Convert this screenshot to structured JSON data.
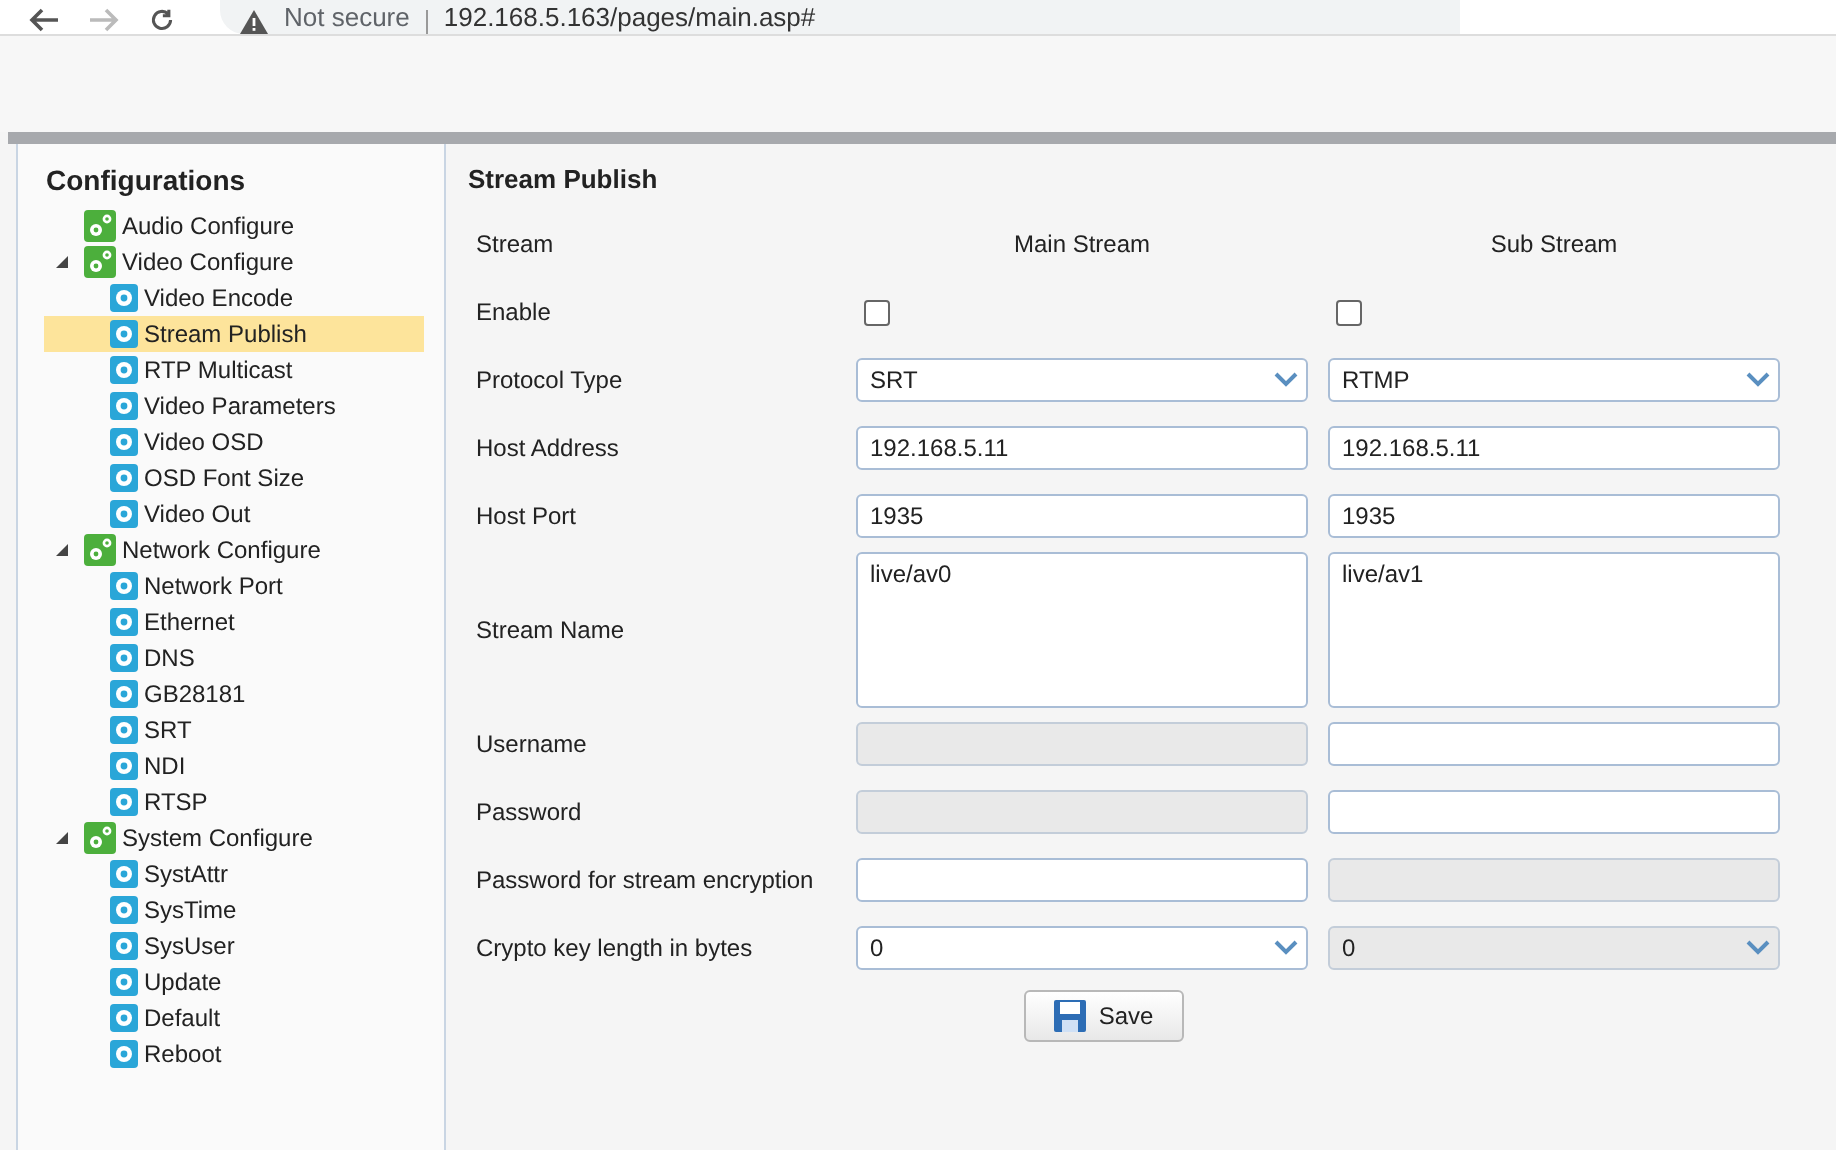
{
  "browser": {
    "security": "Not secure",
    "url": "192.168.5.163/pages/main.asp#"
  },
  "sidebar": {
    "title": "Configurations",
    "items": [
      {
        "label": "Audio Configure",
        "expanded": false,
        "selected": false
      },
      {
        "label": "Video Configure",
        "expanded": true,
        "selected": false,
        "children": [
          {
            "label": "Video Encode",
            "selected": false
          },
          {
            "label": "Stream Publish",
            "selected": true
          },
          {
            "label": "RTP Multicast",
            "selected": false
          },
          {
            "label": "Video Parameters",
            "selected": false
          },
          {
            "label": "Video OSD",
            "selected": false
          },
          {
            "label": "OSD Font Size",
            "selected": false
          },
          {
            "label": "Video Out",
            "selected": false
          }
        ]
      },
      {
        "label": "Network Configure",
        "expanded": true,
        "selected": false,
        "children": [
          {
            "label": "Network Port",
            "selected": false
          },
          {
            "label": "Ethernet",
            "selected": false
          },
          {
            "label": "DNS",
            "selected": false
          },
          {
            "label": "GB28181",
            "selected": false
          },
          {
            "label": "SRT",
            "selected": false
          },
          {
            "label": "NDI",
            "selected": false
          },
          {
            "label": "RTSP",
            "selected": false
          }
        ]
      },
      {
        "label": "System Configure",
        "expanded": true,
        "selected": false,
        "children": [
          {
            "label": "SystAttr",
            "selected": false
          },
          {
            "label": "SysTime",
            "selected": false
          },
          {
            "label": "SysUser",
            "selected": false
          },
          {
            "label": "Update",
            "selected": false
          },
          {
            "label": "Default",
            "selected": false
          },
          {
            "label": "Reboot",
            "selected": false
          }
        ]
      }
    ]
  },
  "panel": {
    "title": "Stream Publish",
    "header": {
      "label": "Stream",
      "columns": [
        "Main Stream",
        "Sub Stream"
      ]
    },
    "rows": [
      {
        "label": "Enable",
        "kind": "checkbox",
        "fields": [
          {
            "checked": false
          },
          {
            "checked": false
          }
        ]
      },
      {
        "label": "Protocol Type",
        "kind": "select",
        "fields": [
          {
            "value": "SRT",
            "disabled": false
          },
          {
            "value": "RTMP",
            "disabled": false
          }
        ]
      },
      {
        "label": "Host Address",
        "kind": "text",
        "fields": [
          {
            "value": "192.168.5.11",
            "disabled": false
          },
          {
            "value": "192.168.5.11",
            "disabled": false
          }
        ]
      },
      {
        "label": "Host Port",
        "kind": "text",
        "fields": [
          {
            "value": "1935",
            "disabled": false
          },
          {
            "value": "1935",
            "disabled": false
          }
        ]
      },
      {
        "label": "Stream Name",
        "kind": "textarea",
        "fields": [
          {
            "value": "live/av0",
            "disabled": false
          },
          {
            "value": "live/av1",
            "disabled": false
          }
        ]
      },
      {
        "label": "Username",
        "kind": "text",
        "fields": [
          {
            "disabled": true
          },
          {
            "disabled": false
          }
        ]
      },
      {
        "label": "Password",
        "kind": "text",
        "fields": [
          {
            "disabled": true
          },
          {
            "disabled": false
          }
        ]
      },
      {
        "label": "Password for stream encryption",
        "kind": "text",
        "fields": [
          {
            "disabled": false
          },
          {
            "disabled": true
          }
        ]
      },
      {
        "label": "Crypto key length in bytes",
        "kind": "select",
        "fields": [
          {
            "value": "0",
            "disabled": false
          },
          {
            "value": "0",
            "disabled": true
          }
        ]
      }
    ],
    "save": "Save"
  }
}
